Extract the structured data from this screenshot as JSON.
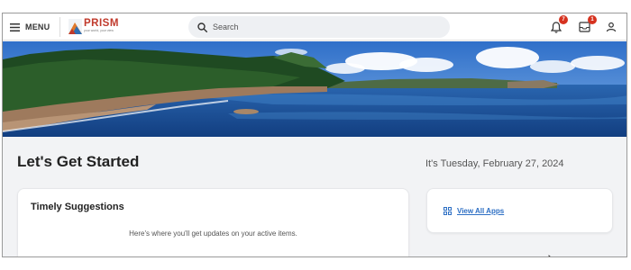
{
  "topbar": {
    "menu_label": "MENU",
    "logo_text": "PRISM",
    "logo_tagline": "your world, your view",
    "search_placeholder": "Search",
    "notifications_count": "7",
    "inbox_count": "1"
  },
  "main": {
    "greeting": "Let's Get Started",
    "date_text": "It's Tuesday, February 27, 2024",
    "suggestions_title": "Timely Suggestions",
    "suggestions_message": "Here's where you'll get updates on your active items.",
    "view_all_apps_label": "View All Apps"
  },
  "colors": {
    "accent_link": "#2d6fc4",
    "badge": "#d6321f",
    "logo_red": "#c0392b"
  }
}
